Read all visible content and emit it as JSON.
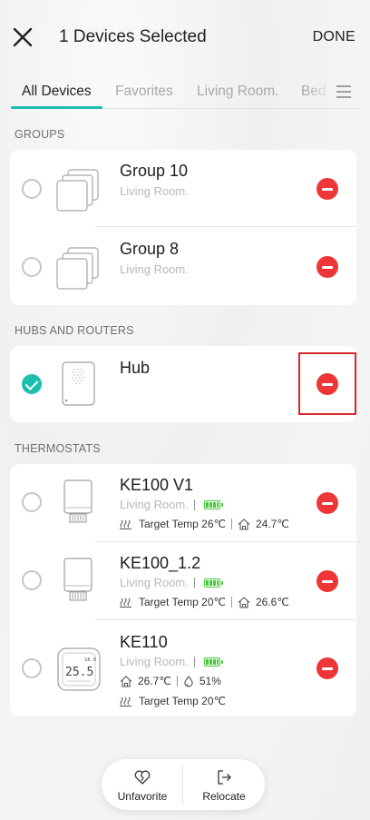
{
  "header": {
    "title": "1 Devices Selected",
    "done_label": "DONE"
  },
  "tabs": [
    {
      "label": "All Devices",
      "active": true
    },
    {
      "label": "Favorites",
      "active": false
    },
    {
      "label": "Living Room.",
      "active": false
    },
    {
      "label": "Bed",
      "active": false
    }
  ],
  "sections": {
    "groups": "GROUPS",
    "hubs": "HUBS AND ROUTERS",
    "thermostats": "THERMOSTATS"
  },
  "groups": [
    {
      "name": "Group 10",
      "room": "Living Room.",
      "selected": false
    },
    {
      "name": "Group 8",
      "room": "Living Room.",
      "selected": false
    }
  ],
  "hubs": [
    {
      "name": "Hub",
      "selected": true
    }
  ],
  "thermostats": [
    {
      "name": "KE100 V1",
      "room": "Living Room.",
      "target_temp": "Target Temp 26℃",
      "current_temp": "24.7℃",
      "selected": false
    },
    {
      "name": "KE100_1.2",
      "room": "Living Room.",
      "target_temp": "Target Temp 20℃",
      "current_temp": "26.6℃",
      "selected": false
    },
    {
      "name": "KE110",
      "room": "Living Room.",
      "current_temp": "26.7℃",
      "humidity": "51%",
      "target_temp": "Target Temp 20℃",
      "display": "25.5",
      "display_small": "18.0",
      "selected": false
    }
  ],
  "actions": {
    "unfavorite": "Unfavorite",
    "relocate": "Relocate"
  },
  "colors": {
    "accent": "#1bbfac",
    "remove": "#ee3636",
    "battery": "#47c83d",
    "highlight": "#d8262c"
  }
}
